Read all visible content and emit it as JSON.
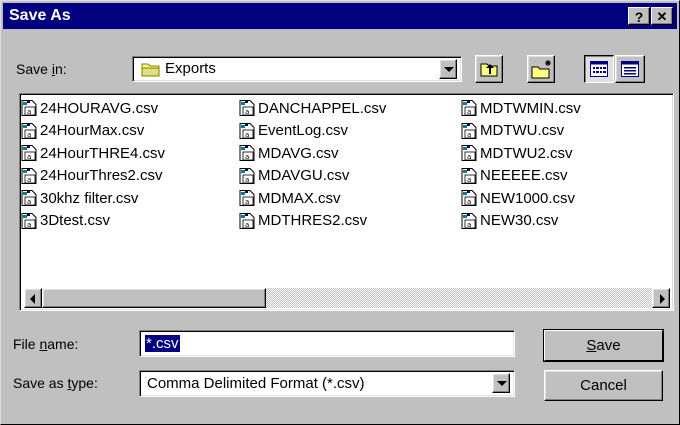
{
  "window": {
    "title": "Save As",
    "help_button": "?",
    "close_button": "✕"
  },
  "save_in": {
    "label_prefix": "Save ",
    "label_accel": "i",
    "label_suffix": "n:",
    "current_folder": "Exports",
    "folder_icon": "folder-icon"
  },
  "toolbar": {
    "up_folder_icon": "up-folder-icon",
    "new_folder_icon": "new-folder-icon",
    "list_view_icon": "list-view-icon",
    "details_view_icon": "details-view-icon"
  },
  "files": [
    [
      "24HOURAVG.csv",
      "24HourMax.csv",
      "24HourTHRE4.csv",
      "24HourThres2.csv",
      "30khz filter.csv",
      "3Dtest.csv"
    ],
    [
      "DANCHAPPEL.csv",
      "EventLog.csv",
      "MDAVG.csv",
      "MDAVGU.csv",
      "MDMAX.csv",
      "MDTHRES2.csv"
    ],
    [
      "MDTWMIN.csv",
      "MDTWU.csv",
      "MDTWU2.csv",
      "NEEEEE.csv",
      "NEW1000.csv",
      "NEW30.csv"
    ]
  ],
  "file_name": {
    "label_prefix": "File ",
    "label_accel": "n",
    "label_suffix": "ame:",
    "value": "*.csv"
  },
  "save_as_type": {
    "label_prefix": "Save as ",
    "label_accel": "t",
    "label_suffix": "ype:",
    "value": "Comma Delimited Format (*.csv)"
  },
  "buttons": {
    "save_accel": "S",
    "save_rest": "ave",
    "cancel": "Cancel"
  },
  "colors": {
    "titlebar": "#000080",
    "face": "#c0c0c0",
    "selection": "#000080"
  }
}
